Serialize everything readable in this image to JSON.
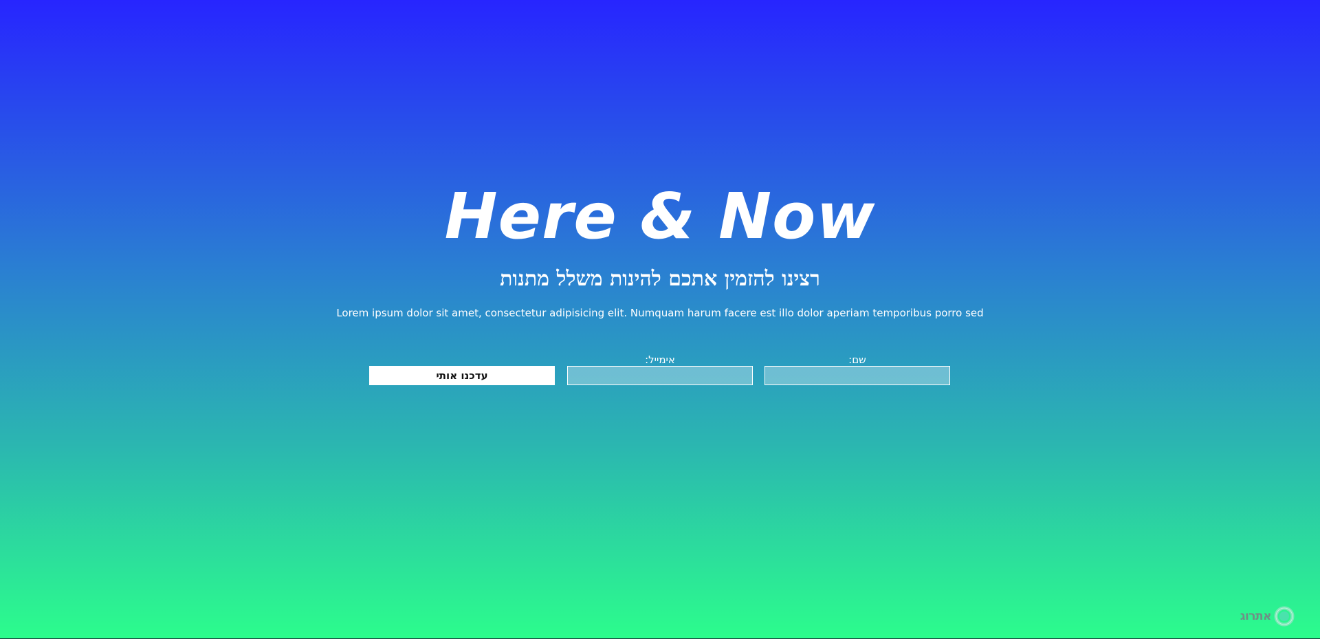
{
  "hero": {
    "title": "Here & Now",
    "subtitle": "רצינו להזמין אתכם להינות משלל מתנות",
    "description": "Lorem ipsum dolor sit amet, consectetur adipisicing elit. Numquam harum facere est illo dolor aperiam temporibus porro sed"
  },
  "form": {
    "name_label": "שם:",
    "name_value": "",
    "email_label": "אימייל:",
    "email_value": "",
    "submit_label": "עדכנו אותי"
  },
  "footer": {
    "logo_text": "אתרוג",
    "logo_icon": "ring-logo-icon"
  },
  "colors": {
    "gradient_top": "#2725ff",
    "gradient_bottom": "#2cfd8c",
    "text": "#ffffff",
    "button_bg": "#ffffff"
  }
}
